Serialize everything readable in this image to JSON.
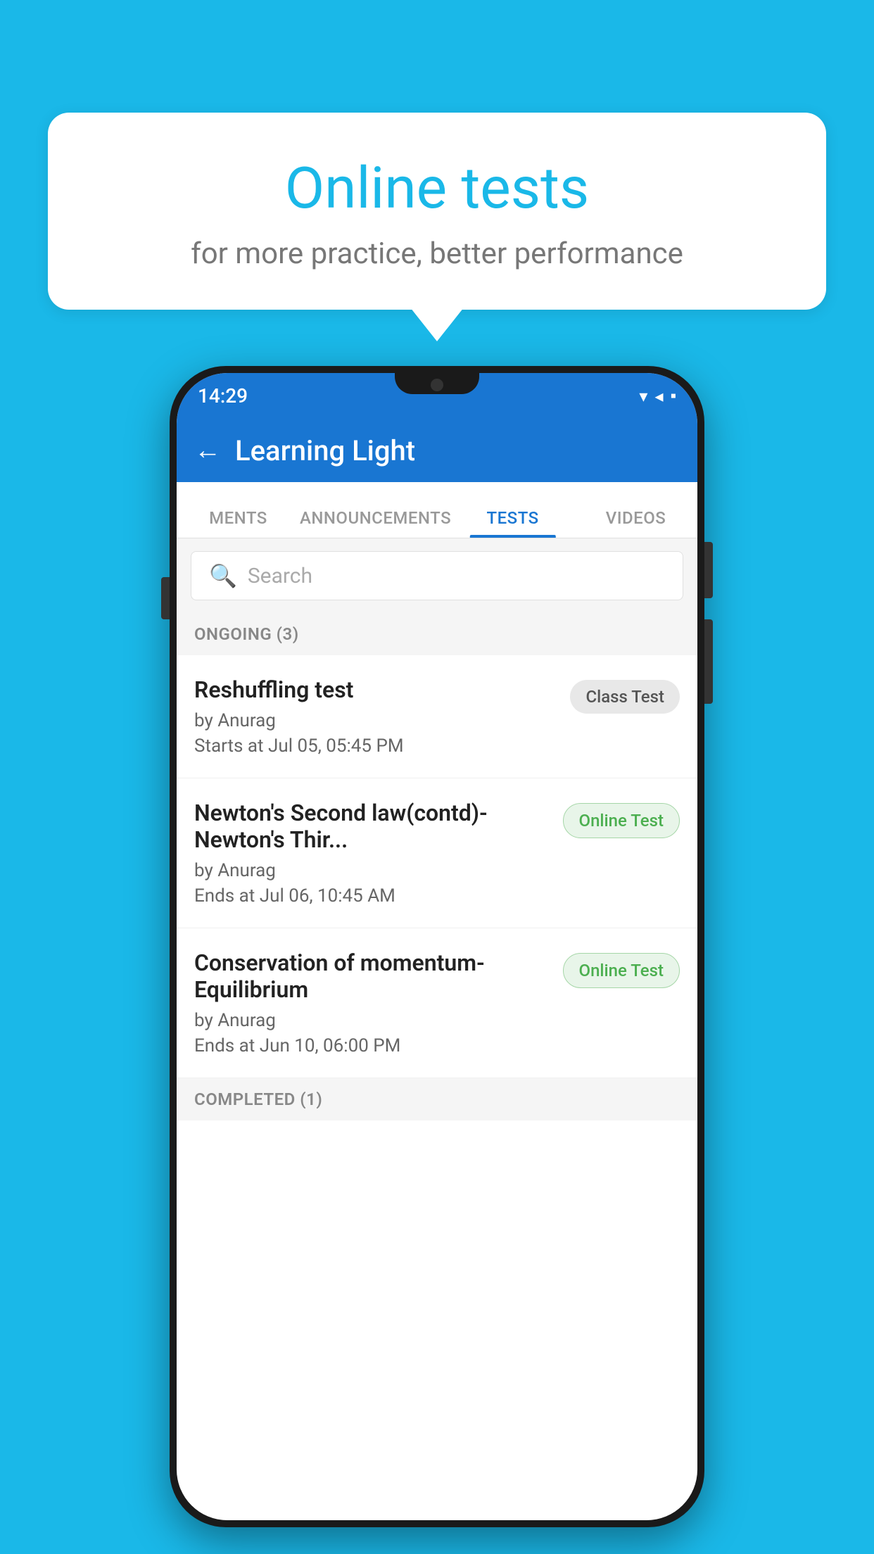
{
  "background": {
    "color": "#1ab8e8"
  },
  "bubble": {
    "title": "Online tests",
    "subtitle": "for more practice, better performance"
  },
  "phone": {
    "status_bar": {
      "time": "14:29",
      "icons": "▾◂▪"
    },
    "header": {
      "title": "Learning Light",
      "back_label": "←"
    },
    "tabs": [
      {
        "label": "MENTS",
        "active": false
      },
      {
        "label": "ANNOUNCEMENTS",
        "active": false
      },
      {
        "label": "TESTS",
        "active": true
      },
      {
        "label": "VIDEOS",
        "active": false
      }
    ],
    "search": {
      "placeholder": "Search"
    },
    "ongoing_section": {
      "label": "ONGOING (3)"
    },
    "tests": [
      {
        "name": "Reshuffling test",
        "author": "by Anurag",
        "time_label": "Starts at",
        "time_value": "Jul 05, 05:45 PM",
        "badge": "Class Test",
        "badge_type": "class"
      },
      {
        "name": "Newton's Second law(contd)-Newton's Thir...",
        "author": "by Anurag",
        "time_label": "Ends at",
        "time_value": "Jul 06, 10:45 AM",
        "badge": "Online Test",
        "badge_type": "online"
      },
      {
        "name": "Conservation of momentum-Equilibrium",
        "author": "by Anurag",
        "time_label": "Ends at",
        "time_value": "Jun 10, 06:00 PM",
        "badge": "Online Test",
        "badge_type": "online"
      }
    ],
    "completed_section": {
      "label": "COMPLETED (1)"
    }
  }
}
